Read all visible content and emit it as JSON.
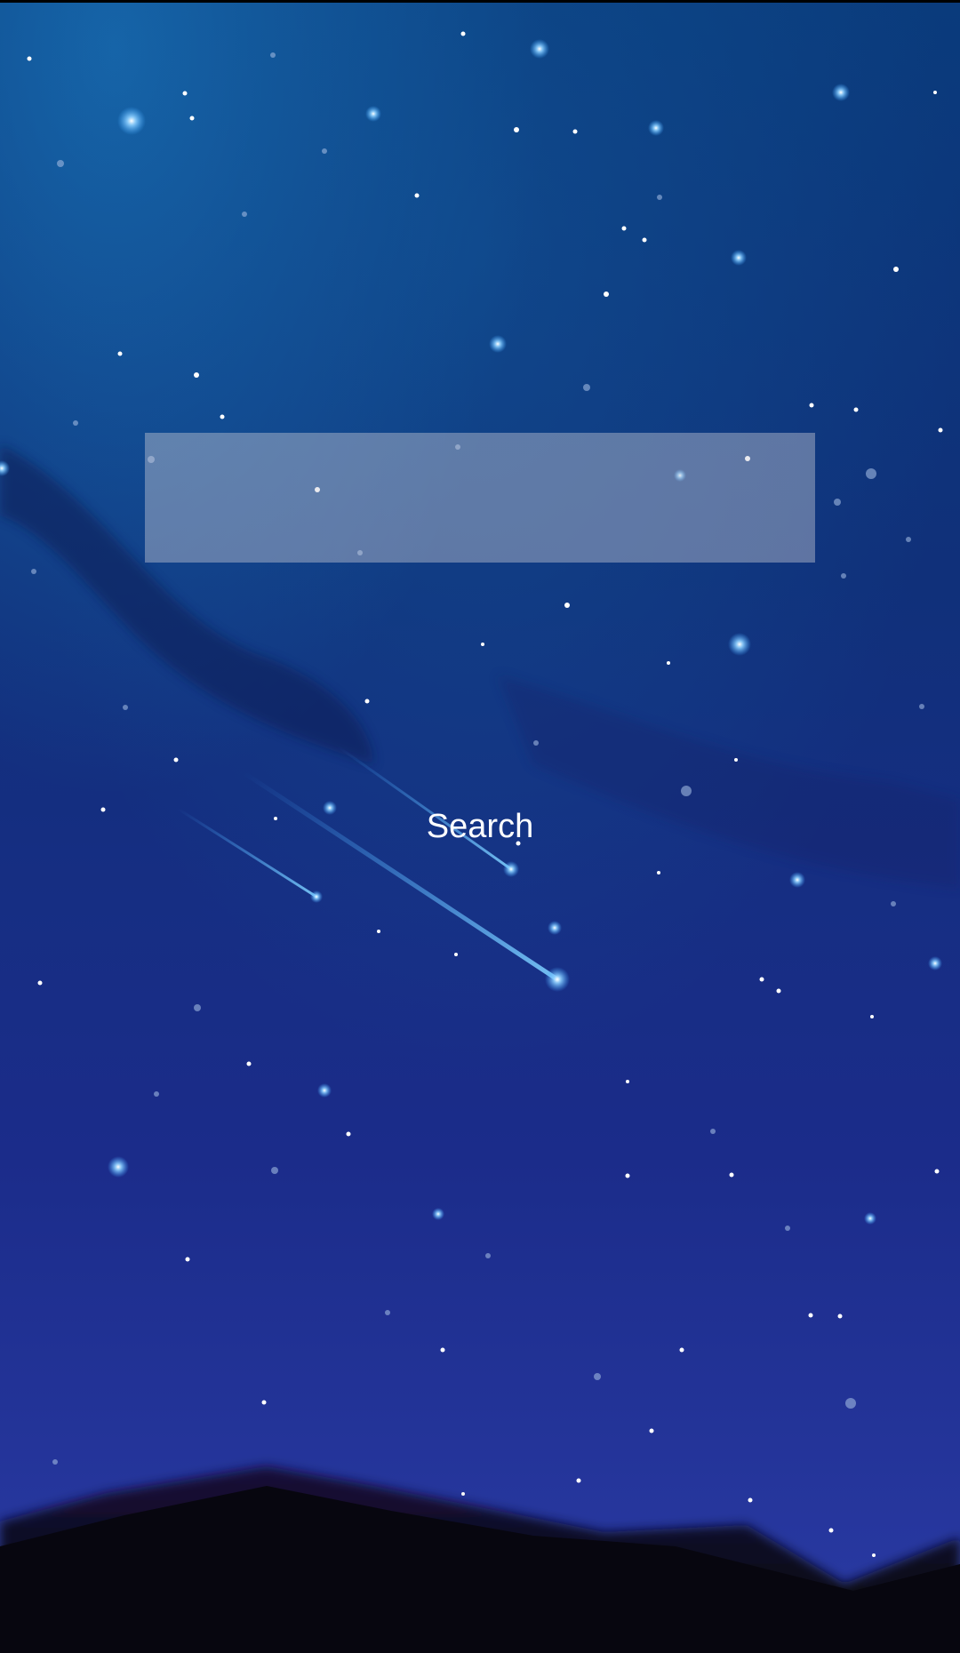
{
  "search": {
    "value": "",
    "placeholder": "",
    "button_label": "Search"
  },
  "wallpaper": {
    "name": "starry-night-sky",
    "sky_color_top": "#0b3d80",
    "sky_color_bottom": "#2838a0",
    "star_glow_color": "#3fa6ff",
    "mountain_color": "#0a0818"
  }
}
